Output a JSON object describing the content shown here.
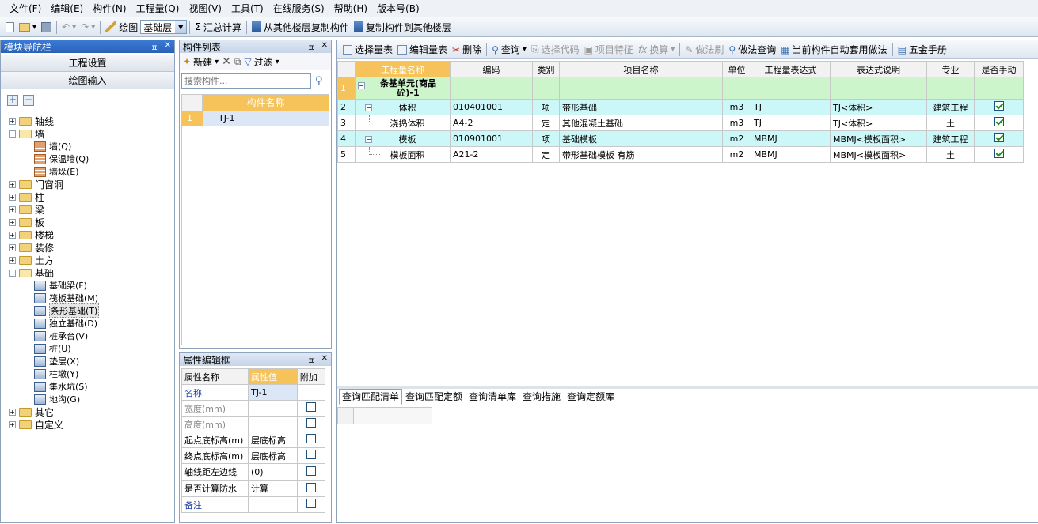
{
  "menu": [
    "文件(F)",
    "编辑(E)",
    "构件(N)",
    "工程量(Q)",
    "视图(V)",
    "工具(T)",
    "在线服务(S)",
    "帮助(H)",
    "版本号(B)"
  ],
  "toolbar": {
    "draw_label": "绘图",
    "layer_value": "基础层",
    "sum_label": "汇总计算",
    "copy_from_floor": "从其他楼层复制构件",
    "copy_to_floor": "复制构件到其他楼层"
  },
  "nav": {
    "title": "模块导航栏",
    "project_settings": "工程设置",
    "drawing_input": "绘图输入",
    "tree": [
      {
        "label": "轴线",
        "level": 0,
        "type": "folder",
        "expanded": false
      },
      {
        "label": "墙",
        "level": 0,
        "type": "folder",
        "expanded": true
      },
      {
        "label": "墙(Q)",
        "level": 1,
        "type": "leaf",
        "icon": "wall-icon"
      },
      {
        "label": "保温墙(Q)",
        "level": 1,
        "type": "leaf",
        "icon": "insulation-wall-icon"
      },
      {
        "label": "墙垛(E)",
        "level": 1,
        "type": "leaf",
        "icon": "wall-pier-icon"
      },
      {
        "label": "门窗洞",
        "level": 0,
        "type": "folder",
        "expanded": false
      },
      {
        "label": "柱",
        "level": 0,
        "type": "folder",
        "expanded": false
      },
      {
        "label": "梁",
        "level": 0,
        "type": "folder",
        "expanded": false
      },
      {
        "label": "板",
        "level": 0,
        "type": "folder",
        "expanded": false
      },
      {
        "label": "楼梯",
        "level": 0,
        "type": "folder",
        "expanded": false
      },
      {
        "label": "装修",
        "level": 0,
        "type": "folder",
        "expanded": false
      },
      {
        "label": "土方",
        "level": 0,
        "type": "folder",
        "expanded": false
      },
      {
        "label": "基础",
        "level": 0,
        "type": "folder",
        "expanded": true
      },
      {
        "label": "基础梁(F)",
        "level": 1,
        "type": "leaf",
        "icon": "foundation-beam-icon"
      },
      {
        "label": "筏板基础(M)",
        "level": 1,
        "type": "leaf",
        "icon": "raft-foundation-icon"
      },
      {
        "label": "条形基础(T)",
        "level": 1,
        "type": "leaf",
        "icon": "strip-foundation-icon",
        "selected": true
      },
      {
        "label": "独立基础(D)",
        "level": 1,
        "type": "leaf",
        "icon": "isolated-foundation-icon"
      },
      {
        "label": "桩承台(V)",
        "level": 1,
        "type": "leaf",
        "icon": "pile-cap-icon"
      },
      {
        "label": "桩(U)",
        "level": 1,
        "type": "leaf",
        "icon": "pile-icon"
      },
      {
        "label": "垫层(X)",
        "level": 1,
        "type": "leaf",
        "icon": "cushion-icon"
      },
      {
        "label": "柱墩(Y)",
        "level": 1,
        "type": "leaf",
        "icon": "column-pier-icon"
      },
      {
        "label": "集水坑(S)",
        "level": 1,
        "type": "leaf",
        "icon": "sump-icon"
      },
      {
        "label": "地沟(G)",
        "level": 1,
        "type": "leaf",
        "icon": "trench-icon"
      },
      {
        "label": "其它",
        "level": 0,
        "type": "folder",
        "expanded": false
      },
      {
        "label": "自定义",
        "level": 0,
        "type": "folder",
        "expanded": false
      }
    ]
  },
  "components": {
    "title": "构件列表",
    "new_label": "新建",
    "filter_label": "过滤",
    "search_placeholder": "搜索构件...",
    "header": "构件名称",
    "rows": [
      {
        "num": "1",
        "name": "TJ-1"
      }
    ]
  },
  "properties": {
    "title": "属性编辑框",
    "headers": [
      "属性名称",
      "属性值",
      "附加"
    ],
    "rows": [
      {
        "name": "名称",
        "value": "TJ-1",
        "blue": true,
        "check": false
      },
      {
        "name": "宽度(mm)",
        "value": "",
        "blue": false,
        "check": true
      },
      {
        "name": "高度(mm)",
        "value": "",
        "blue": false,
        "check": true
      },
      {
        "name": "起点底标高(m)",
        "value": "层底标高",
        "blue": false,
        "check": true
      },
      {
        "name": "终点底标高(m)",
        "value": "层底标高",
        "blue": false,
        "check": true
      },
      {
        "name": "轴线距左边线",
        "value": "(0)",
        "blue": false,
        "check": true
      },
      {
        "name": "是否计算防水",
        "value": "计算",
        "blue": false,
        "check": true
      },
      {
        "name": "备注",
        "value": "",
        "blue": true,
        "check": true
      }
    ]
  },
  "quantity_toolbar": {
    "select_table": "选择量表",
    "edit_table": "编辑量表",
    "delete": "删除",
    "query": "查询",
    "select_code": "选择代码",
    "item_feature": "项目特征",
    "convert": "换算",
    "brush": "做法刷",
    "method_query": "做法查询",
    "auto_apply": "当前构件自动套用做法",
    "hardware_manual": "五金手册"
  },
  "quantity_table": {
    "headers": [
      "工程量名称",
      "编码",
      "类别",
      "项目名称",
      "单位",
      "工程量表达式",
      "表达式说明",
      "专业",
      "是否手动"
    ],
    "rows": [
      {
        "num": "1",
        "name": "条基单元(商品砼)-1",
        "code": "",
        "cat": "",
        "item": "",
        "unit": "",
        "expr": "",
        "desc": "",
        "major": "",
        "manual": false,
        "kind": "group"
      },
      {
        "num": "2",
        "name": "体积",
        "code": "010401001",
        "cat": "项",
        "item": "带形基础",
        "unit": "m3",
        "expr": "TJ",
        "desc": "TJ<体积>",
        "major": "建筑工程",
        "manual": true,
        "kind": "item"
      },
      {
        "num": "3",
        "name": "浇捣体积",
        "code": "A4-2",
        "cat": "定",
        "item": "其他混凝土基础",
        "unit": "m3",
        "expr": "TJ",
        "desc": "TJ<体积>",
        "major": "土",
        "manual": true,
        "kind": "sub"
      },
      {
        "num": "4",
        "name": "模板",
        "code": "010901001",
        "cat": "项",
        "item": "基础模板",
        "unit": "m2",
        "expr": "MBMJ",
        "desc": "MBMJ<模板面积>",
        "major": "建筑工程",
        "manual": true,
        "kind": "item"
      },
      {
        "num": "5",
        "name": "模板面积",
        "code": "A21-2",
        "cat": "定",
        "item": "带形基础模板 有筋",
        "unit": "m2",
        "expr": "MBMJ",
        "desc": "MBMJ<模板面积>",
        "major": "土",
        "manual": true,
        "kind": "sub"
      }
    ]
  },
  "bottom_tabs": [
    "查询匹配清单",
    "查询匹配定额",
    "查询清单库",
    "查询措施",
    "查询定额库"
  ],
  "colors": {
    "group_row": "#ccf5cc",
    "item_row": "#ccf7f8",
    "header_highlight": "#f5c35a",
    "selected": "#dbe7f7"
  }
}
